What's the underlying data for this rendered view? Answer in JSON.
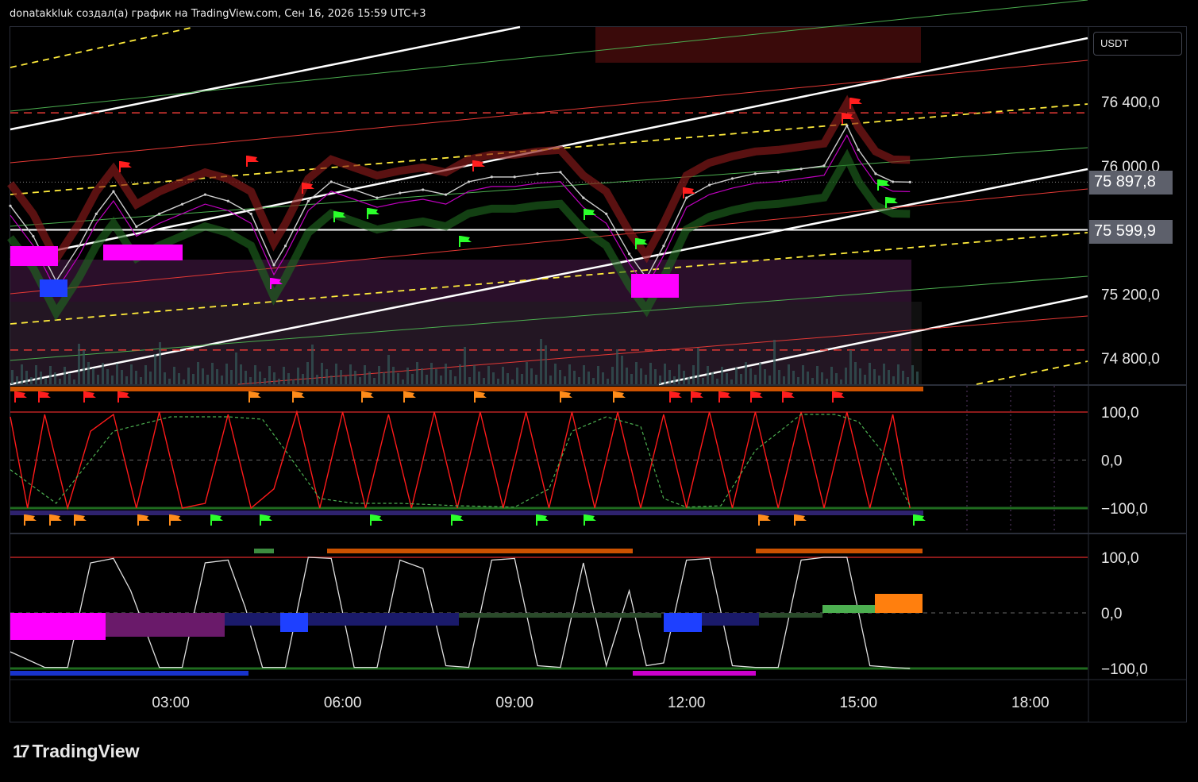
{
  "header": {
    "caption": "donatakkluk создал(а) график на TradingView.com, Сен 16, 2026 15:59 UTC+3"
  },
  "currency": "USDT",
  "price_tags": {
    "last": "75 897,8",
    "line": "75 599,9"
  },
  "logo": {
    "text": "TradingView"
  },
  "colors": {
    "background": "#000000",
    "candle_up": "#cfcfcf",
    "channel_main": "#ffffff",
    "channel_mid": "#ffeb3b",
    "channel_green": "#4caf50",
    "channel_red": "#e53935",
    "osc_red": "#ff1a1a",
    "osc_green_dashed": "#4caf50",
    "osc_white": "#e0e0e0",
    "magenta": "#ff00ff",
    "blue": "#1e40ff",
    "orange": "#ff7f0e",
    "flag_red": "#ff1e1e",
    "flag_green": "#2bff2b",
    "flag_orange": "#ff8c1a"
  },
  "chart_data": [
    {
      "type": "line",
      "title": "",
      "yaxis": {
        "ticks": [
          "76 400,0",
          "76 000,0",
          "75 200,0",
          "74 800,0"
        ],
        "tick_values": [
          76400,
          76000,
          75200,
          74800
        ],
        "range": [
          74620,
          76830
        ]
      },
      "xaxis": {
        "ticks": [
          "03:00",
          "06:00",
          "09:00",
          "12:00",
          "15:00",
          "18:00"
        ],
        "tick_hours": [
          3,
          6,
          9,
          12,
          15,
          18
        ],
        "range_hours": [
          0.2,
          19.0
        ]
      },
      "series": [
        {
          "x_hours": [
            0.2,
            0.6,
            1.0,
            1.4,
            1.7,
            2.0,
            2.4,
            2.8,
            3.2,
            3.6,
            4.0,
            4.4,
            4.8,
            5.0,
            5.4,
            5.8,
            6.2,
            6.6,
            7.0,
            7.4,
            7.8,
            8.2,
            8.6,
            9.0,
            9.4,
            9.8,
            10.2,
            10.6,
            11.0,
            11.3,
            11.6,
            12.0,
            12.4,
            12.8,
            13.2,
            13.6,
            14.0,
            14.4,
            14.8,
            15.0,
            15.3,
            15.6,
            15.9
          ],
          "values": [
            75750,
            75560,
            75280,
            75500,
            75700,
            75840,
            75620,
            75700,
            75760,
            75820,
            75780,
            75700,
            75380,
            75500,
            75780,
            75900,
            75850,
            75800,
            75830,
            75850,
            75820,
            75900,
            75930,
            75930,
            75950,
            75960,
            75800,
            75700,
            75450,
            75300,
            75500,
            75800,
            75880,
            75920,
            75950,
            75960,
            75980,
            76000,
            76250,
            76100,
            75950,
            75900,
            75897.8
          ]
        }
      ],
      "horizontal_lines": [
        {
          "value": 75599.9,
          "style": "solid",
          "color": "#ffffff"
        },
        {
          "value": 76330,
          "style": "dashed",
          "color": "#e53935"
        },
        {
          "value": 74850,
          "style": "dashed",
          "color": "#e53935"
        }
      ],
      "last_price": 75897.8
    },
    {
      "type": "line",
      "title": "",
      "yaxis": {
        "ticks": [
          "100,0",
          "0,0",
          "−100,0"
        ],
        "tick_values": [
          100,
          0,
          -100
        ],
        "range": [
          -130,
          130
        ]
      },
      "xaxis": {
        "range_hours": [
          0.2,
          19.0
        ]
      },
      "series": [
        {
          "x_hours": [
            0.2,
            0.5,
            0.8,
            1.2,
            1.6,
            2.0,
            2.4,
            2.8,
            3.2,
            3.6,
            4.0,
            4.4,
            4.8,
            5.2,
            5.6,
            6.0,
            6.4,
            6.8,
            7.2,
            7.6,
            8.0,
            8.4,
            8.8,
            9.2,
            9.6,
            10.0,
            10.4,
            10.8,
            11.2,
            11.6,
            12.0,
            12.4,
            12.8,
            13.2,
            13.6,
            14.0,
            14.4,
            14.8,
            15.2,
            15.6,
            15.9
          ],
          "values": [
            90,
            -100,
            95,
            -100,
            60,
            95,
            -100,
            100,
            -100,
            -90,
            95,
            -100,
            -60,
            100,
            -100,
            100,
            -100,
            95,
            -100,
            100,
            -100,
            100,
            -100,
            100,
            -100,
            100,
            -100,
            100,
            -100,
            95,
            -100,
            100,
            -100,
            100,
            -100,
            100,
            -100,
            100,
            -100,
            95,
            -100
          ]
        },
        {
          "x_hours": [
            0.2,
            1.0,
            2.0,
            3.0,
            4.0,
            4.6,
            5.0,
            5.6,
            6.2,
            7.0,
            8.0,
            9.0,
            9.6,
            10.0,
            10.6,
            11.2,
            11.6,
            12.0,
            12.6,
            13.2,
            14.0,
            14.6,
            15.0,
            15.4,
            15.9
          ],
          "values": [
            -20,
            -90,
            60,
            90,
            90,
            85,
            20,
            -80,
            -90,
            -90,
            -95,
            -98,
            -60,
            60,
            90,
            70,
            -80,
            -98,
            -95,
            20,
            95,
            95,
            80,
            20,
            -95
          ]
        }
      ]
    },
    {
      "type": "line",
      "title": "",
      "yaxis": {
        "ticks": [
          "100,0",
          "0,0",
          "−100,0"
        ],
        "tick_values": [
          100,
          0,
          -100
        ],
        "range": [
          -130,
          130
        ]
      },
      "xaxis": {
        "range_hours": [
          0.2,
          19.0
        ]
      },
      "series": [
        {
          "x_hours": [
            0.2,
            0.8,
            1.2,
            1.6,
            2.0,
            2.3,
            2.8,
            3.2,
            3.6,
            4.0,
            4.3,
            4.6,
            5.0,
            5.4,
            5.8,
            6.2,
            6.6,
            7.0,
            7.4,
            7.8,
            8.2,
            8.6,
            9.0,
            9.4,
            9.8,
            10.2,
            10.6,
            11.0,
            11.3,
            11.6,
            12.0,
            12.4,
            12.8,
            13.2,
            13.6,
            14.0,
            14.4,
            14.8,
            15.2,
            15.6,
            15.9
          ],
          "values": [
            -70,
            -98,
            -98,
            90,
            98,
            40,
            -98,
            -98,
            90,
            95,
            10,
            -98,
            -98,
            100,
            98,
            -98,
            -98,
            95,
            80,
            -95,
            -98,
            95,
            98,
            -95,
            -98,
            90,
            -95,
            40,
            -95,
            -90,
            95,
            98,
            -95,
            -98,
            -98,
            95,
            100,
            100,
            -95,
            -98,
            -100
          ]
        }
      ]
    }
  ]
}
